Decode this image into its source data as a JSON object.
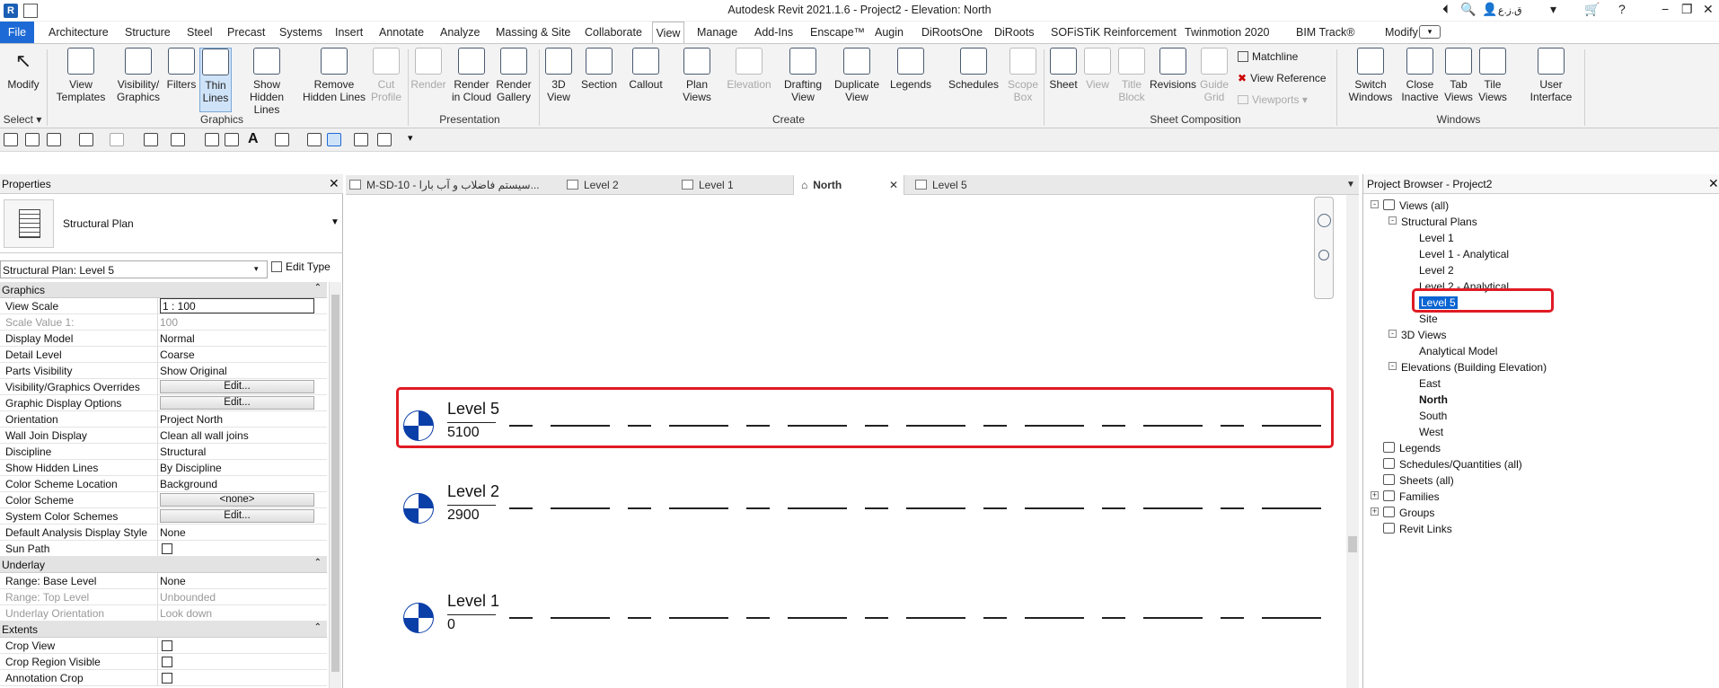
{
  "window": {
    "title": "Autodesk Revit 2021.1.6 - Project2 - Elevation: North",
    "user": "ق.ز.ع"
  },
  "ribbon_tabs": [
    "File",
    "Architecture",
    "Structure",
    "Steel",
    "Precast",
    "Systems",
    "Insert",
    "Annotate",
    "Analyze",
    "Massing & Site",
    "Collaborate",
    "View",
    "Manage",
    "Add-Ins",
    "Enscape™",
    "Augin",
    "DiRootsOne",
    "DiRoots",
    "SOFiSTiK Reinforcement",
    "Twinmotion 2020",
    "BIM Track®",
    "Modify"
  ],
  "ribbon_active_tab": "View",
  "ribbon": {
    "select": {
      "modify": "Modify",
      "select": "Select"
    },
    "graphics": {
      "label": "Graphics",
      "view_templates": [
        "View",
        "Templates"
      ],
      "visibility": [
        "Visibility/",
        "Graphics"
      ],
      "filters": "Filters",
      "thin_lines": [
        "Thin",
        "Lines"
      ],
      "show_hidden": [
        "Show",
        "Hidden Lines"
      ],
      "remove_hidden": [
        "Remove",
        "Hidden Lines"
      ],
      "cut_profile": [
        "Cut",
        "Profile"
      ]
    },
    "presentation": {
      "label": "Presentation",
      "render": "Render",
      "render_cloud": [
        "Render",
        "in Cloud"
      ],
      "render_gallery": [
        "Render",
        "Gallery"
      ]
    },
    "create": {
      "label": "Create",
      "view3d": [
        "3D",
        "View"
      ],
      "section": "Section",
      "callout": "Callout",
      "plan_views": [
        "Plan",
        "Views"
      ],
      "elevation": "Elevation",
      "drafting": [
        "Drafting",
        "View"
      ],
      "duplicate": [
        "Duplicate",
        "View"
      ],
      "legends": "Legends",
      "schedules": "Schedules",
      "scope_box": [
        "Scope",
        "Box"
      ]
    },
    "sheet": {
      "label": "Sheet Composition",
      "sheet": "Sheet",
      "view": "View",
      "title_block": [
        "Title",
        "Block"
      ],
      "revisions": "Revisions",
      "guide_grid": [
        "Guide",
        "Grid"
      ],
      "matchline": "Matchline",
      "view_reference": "View  Reference",
      "viewports": "Viewports"
    },
    "windows": {
      "label": "Windows",
      "switch": [
        "Switch",
        "Windows"
      ],
      "close_inactive": [
        "Close",
        "Inactive"
      ],
      "tab_views": [
        "Tab",
        "Views"
      ],
      "tile_views": [
        "Tile",
        "Views"
      ],
      "user_interface": [
        "User",
        "Interface"
      ]
    }
  },
  "properties": {
    "title": "Properties",
    "type_name": "Structural Plan",
    "instance": "Structural Plan: Level 5",
    "edit_type": "Edit Type",
    "groups": [
      {
        "name": "Graphics",
        "rows": [
          {
            "k": "View Scale",
            "v": "1 : 100",
            "kind": "input"
          },
          {
            "k": "Scale Value    1:",
            "v": "100",
            "kind": "gray"
          },
          {
            "k": "Display Model",
            "v": "Normal"
          },
          {
            "k": "Detail Level",
            "v": "Coarse"
          },
          {
            "k": "Parts Visibility",
            "v": "Show Original"
          },
          {
            "k": "Visibility/Graphics Overrides",
            "v": "Edit...",
            "kind": "button"
          },
          {
            "k": "Graphic Display Options",
            "v": "Edit...",
            "kind": "button"
          },
          {
            "k": "Orientation",
            "v": "Project North"
          },
          {
            "k": "Wall Join Display",
            "v": "Clean all wall joins"
          },
          {
            "k": "Discipline",
            "v": "Structural"
          },
          {
            "k": "Show Hidden Lines",
            "v": "By Discipline"
          },
          {
            "k": "Color Scheme Location",
            "v": "Background"
          },
          {
            "k": "Color Scheme",
            "v": "<none>",
            "kind": "button"
          },
          {
            "k": "System Color Schemes",
            "v": "Edit...",
            "kind": "button"
          },
          {
            "k": "Default Analysis Display Style",
            "v": "None"
          },
          {
            "k": "Sun Path",
            "v": "",
            "kind": "checkbox"
          }
        ]
      },
      {
        "name": "Underlay",
        "rows": [
          {
            "k": "Range: Base Level",
            "v": "None"
          },
          {
            "k": "Range: Top Level",
            "v": "Unbounded",
            "kind": "gray"
          },
          {
            "k": "Underlay Orientation",
            "v": "Look down",
            "kind": "gray"
          }
        ]
      },
      {
        "name": "Extents",
        "rows": [
          {
            "k": "Crop View",
            "v": "",
            "kind": "checkbox"
          },
          {
            "k": "Crop Region Visible",
            "v": "",
            "kind": "checkbox"
          },
          {
            "k": "Annotation Crop",
            "v": "",
            "kind": "checkbox"
          }
        ]
      }
    ]
  },
  "view_tabs": [
    {
      "label": "M-SD-10 - سیستم فاضلاب و آب بارا..."
    },
    {
      "label": "Level 2"
    },
    {
      "label": "Level 1"
    },
    {
      "label": "North",
      "active": true
    },
    {
      "label": "Level 5"
    }
  ],
  "levels": [
    {
      "name": "Level 5",
      "elevation": "5100",
      "highlighted": true
    },
    {
      "name": "Level 2",
      "elevation": "2900"
    },
    {
      "name": "Level 1",
      "elevation": "0"
    }
  ],
  "browser": {
    "title": "Project Browser - Project2",
    "nodes": [
      {
        "label": "Views (all)",
        "depth": 0,
        "exp": "-"
      },
      {
        "label": "Structural Plans",
        "depth": 1,
        "exp": "-"
      },
      {
        "label": "Level 1",
        "depth": 2
      },
      {
        "label": "Level 1 - Analytical",
        "depth": 2
      },
      {
        "label": "Level 2",
        "depth": 2
      },
      {
        "label": "Level 2 - Analytical",
        "depth": 2
      },
      {
        "label": "Level 5",
        "depth": 2,
        "selected": true
      },
      {
        "label": "Site",
        "depth": 2
      },
      {
        "label": "3D Views",
        "depth": 1,
        "exp": "-"
      },
      {
        "label": "Analytical Model",
        "depth": 2
      },
      {
        "label": "Elevations (Building Elevation)",
        "depth": 1,
        "exp": "-"
      },
      {
        "label": "East",
        "depth": 2
      },
      {
        "label": "North",
        "depth": 2,
        "bold": true
      },
      {
        "label": "South",
        "depth": 2
      },
      {
        "label": "West",
        "depth": 2
      },
      {
        "label": "Legends",
        "depth": 0,
        "icon": true
      },
      {
        "label": "Schedules/Quantities (all)",
        "depth": 0,
        "icon": true
      },
      {
        "label": "Sheets (all)",
        "depth": 0,
        "icon": true
      },
      {
        "label": "Families",
        "depth": 0,
        "exp": "+",
        "icon": true
      },
      {
        "label": "Groups",
        "depth": 0,
        "exp": "+",
        "icon": true
      },
      {
        "label": "Revit Links",
        "depth": 0,
        "icon": true
      }
    ]
  },
  "colors": {
    "accent": "#1d6ad6",
    "highlight": "#e01b24",
    "selection": "#0a64d2",
    "level_head": "#0b3fa8"
  }
}
